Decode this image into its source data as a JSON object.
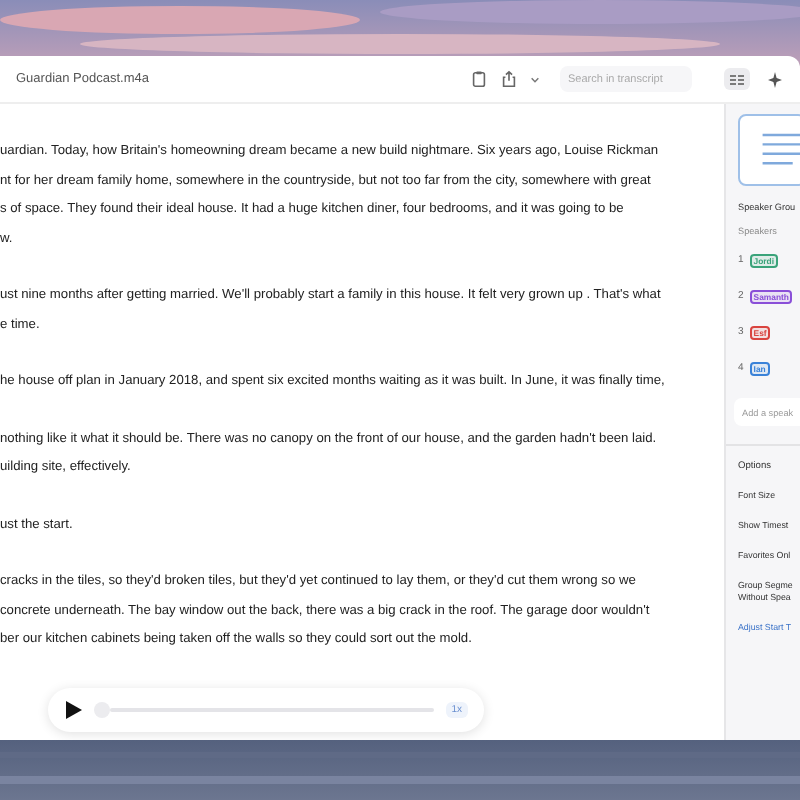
{
  "window": {
    "title": "Guardian Podcast.m4a"
  },
  "toolbar": {
    "search": {
      "placeholder": "Search in transcript"
    }
  },
  "transcript": {
    "paragraphs": [
      {
        "lines": [
          "uardian. Today, how Britain's homeowning dream became a new build nightmare. Six years ago, Louise Rickman",
          "nt for her dream family home, somewhere in the countryside, but not too far from the city, somewhere with great",
          "s of space. They found their ideal house. It had a huge kitchen diner, four bedrooms, and it was going to be",
          "w."
        ]
      },
      {
        "lines": [
          "ust nine months after getting married. We'll probably start a family in this house. It felt very grown up . That's what",
          "e time."
        ]
      },
      {
        "lines": [
          "he house off plan in January 2018, and spent six excited months waiting as it was built. In June, it was finally time,"
        ]
      },
      {
        "lines": [
          "nothing like it what it should be. There was no canopy on the front of our house, and the garden hadn't been laid.",
          "uilding site, effectively."
        ]
      },
      {
        "lines": [
          "ust the start."
        ]
      },
      {
        "lines": [
          "cracks in the tiles, so they'd broken tiles, but they'd yet continued to lay them, or they'd cut them wrong so we",
          "concrete underneath. The bay window out the back, there was a big crack in the roof. The garage door wouldn't",
          "ber our kitchen cabinets being taken off the walls so they could sort out the mold."
        ]
      }
    ]
  },
  "player": {
    "level": 0.0,
    "speed": "1x"
  },
  "sidebar": {
    "heading": "Speaker Grou",
    "speakers_label": "Speakers",
    "speakers": [
      {
        "number": "1",
        "name": "Jordi",
        "color": "#3aa37a"
      },
      {
        "number": "2",
        "name": "Samanth",
        "color": "#8a4fd8"
      },
      {
        "number": "3",
        "name": "Esf",
        "color": "#d9443f"
      },
      {
        "number": "4",
        "name": "Ian",
        "color": "#3a82d8"
      }
    ],
    "add_speaker": {
      "placeholder": "Add a speak"
    },
    "options_label": "Options",
    "options": [
      {
        "kind": "option",
        "lines": [
          "Font Size"
        ]
      },
      {
        "kind": "option",
        "lines": [
          "Show Timest"
        ]
      },
      {
        "kind": "option",
        "lines": [
          "Favorites Onl"
        ]
      },
      {
        "kind": "option",
        "lines": [
          "Group Segme",
          "Without Spea"
        ]
      },
      {
        "kind": "link",
        "lines": [
          "Adjust Start T"
        ]
      }
    ]
  }
}
